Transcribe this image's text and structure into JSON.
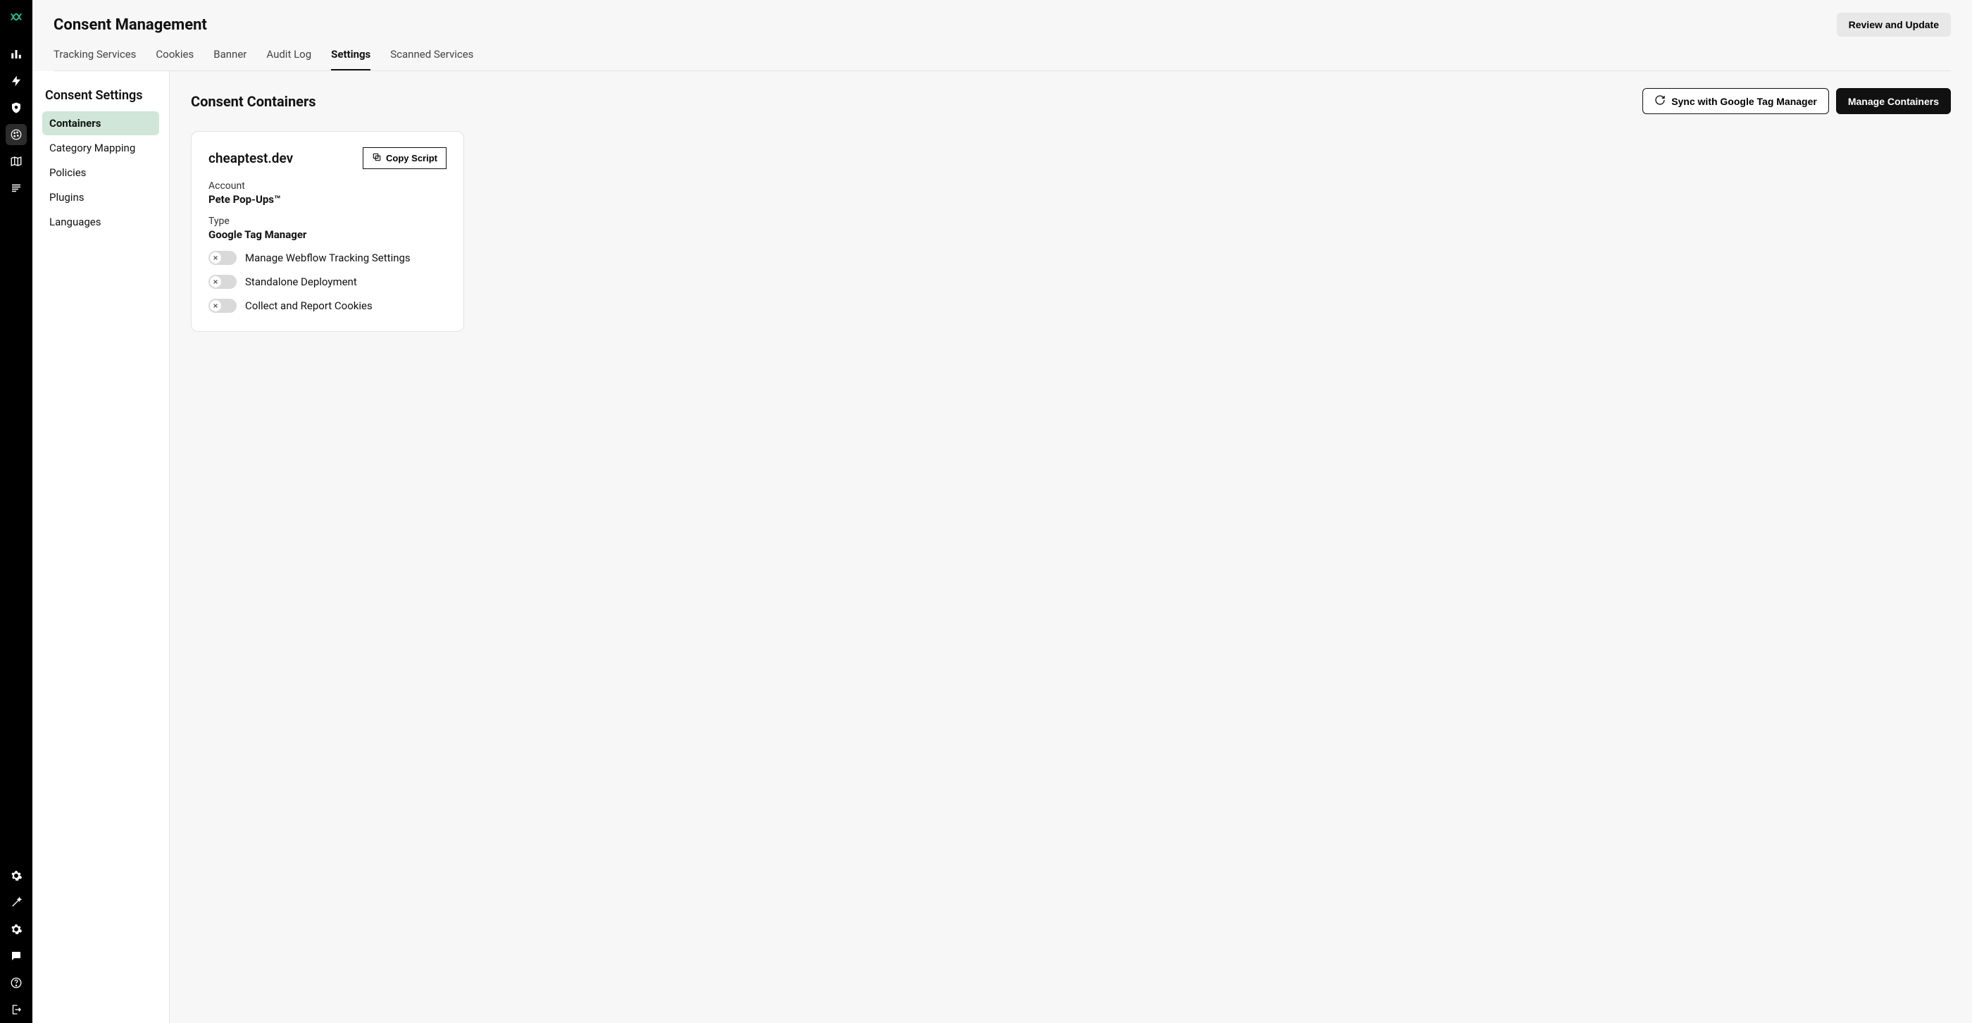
{
  "header": {
    "page_title": "Consent Management",
    "review_button": "Review and Update"
  },
  "tabs": [
    {
      "label": "Tracking Services",
      "active": false
    },
    {
      "label": "Cookies",
      "active": false
    },
    {
      "label": "Banner",
      "active": false
    },
    {
      "label": "Audit Log",
      "active": false
    },
    {
      "label": "Settings",
      "active": true
    },
    {
      "label": "Scanned Services",
      "active": false
    }
  ],
  "sidebar": {
    "title": "Consent Settings",
    "items": [
      {
        "label": "Containers",
        "active": true
      },
      {
        "label": "Category Mapping",
        "active": false
      },
      {
        "label": "Policies",
        "active": false
      },
      {
        "label": "Plugins",
        "active": false
      },
      {
        "label": "Languages",
        "active": false
      }
    ]
  },
  "panel": {
    "title": "Consent Containers",
    "sync_button": "Sync with Google Tag Manager",
    "manage_button": "Manage Containers"
  },
  "container_card": {
    "domain": "cheaptest.dev",
    "copy_button": "Copy Script",
    "account_label": "Account",
    "account_value": "Pete Pop-Ups™",
    "type_label": "Type",
    "type_value": "Google Tag Manager",
    "toggles": [
      {
        "label": "Manage Webflow Tracking Settings",
        "on": false
      },
      {
        "label": "Standalone Deployment",
        "on": false
      },
      {
        "label": "Collect and Report Cookies",
        "on": false
      }
    ]
  }
}
